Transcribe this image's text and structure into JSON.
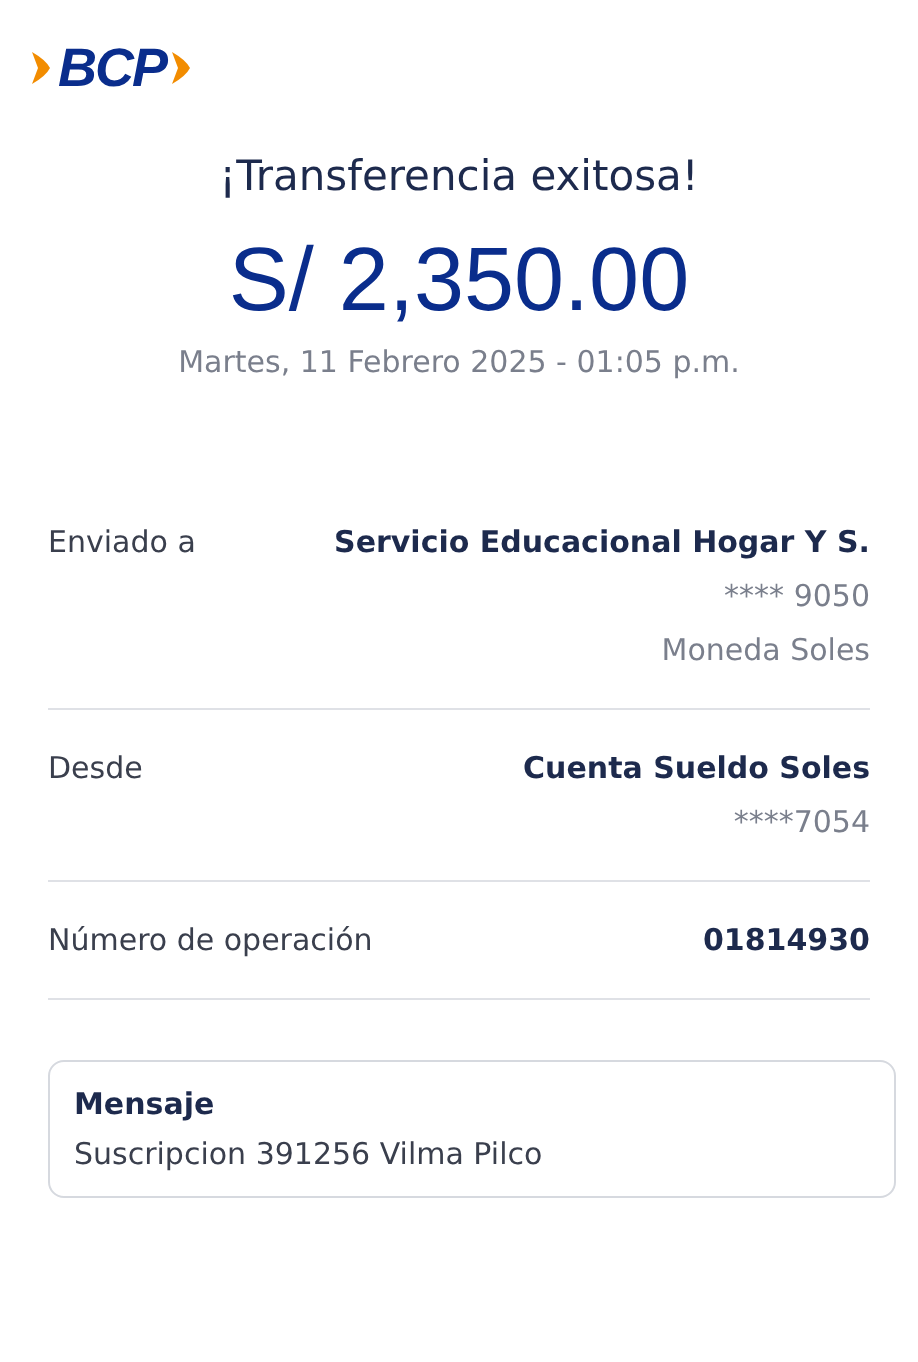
{
  "logo": {
    "text": "BCP"
  },
  "title": "¡Transferencia exitosa!",
  "amount": "S/ 2,350.00",
  "date": "Martes, 11 Febrero 2025 - 01:05 p.m.",
  "details": [
    {
      "label": "Enviado a",
      "value": "Servicio Educacional Hogar Y S.",
      "extra": [
        "**** 9050",
        "Moneda Soles"
      ]
    },
    {
      "label": "Desde",
      "value": "Cuenta Sueldo Soles",
      "extra": [
        "****7054"
      ]
    },
    {
      "label": "Número de operación",
      "value": "01814930"
    }
  ],
  "message": {
    "title": "Mensaje",
    "text": "Suscripcion 391256 Vilma Pilco"
  }
}
